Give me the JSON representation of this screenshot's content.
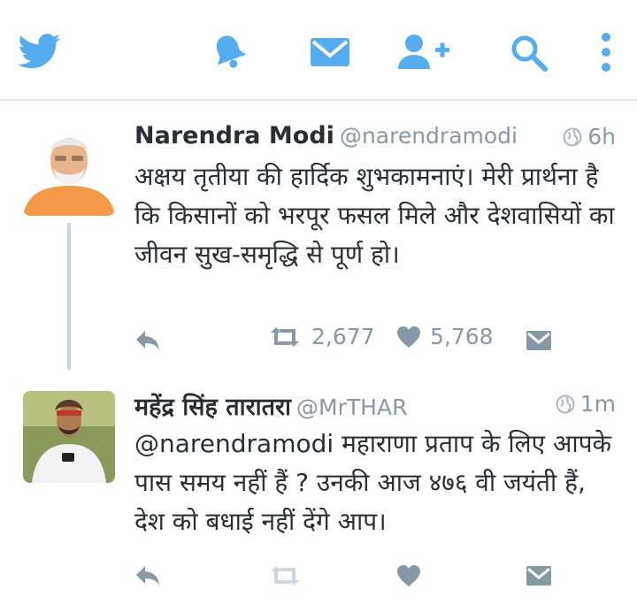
{
  "colors": {
    "brand": "#55acee",
    "muted": "#8899a6",
    "text": "#292f33",
    "divider": "#e1e8ed"
  },
  "nav": {
    "icons": [
      "twitter-bird-icon",
      "notifications-bell-icon",
      "messages-envelope-icon",
      "add-user-icon",
      "search-icon",
      "more-options-icon"
    ]
  },
  "tweets": [
    {
      "name": "Narendra Modi",
      "handle": "@narendramodi",
      "time": "6h",
      "text": "अक्षय तृतीया की हार्दिक शुभकामनाएं। मेरी प्रार्थना है कि किसानों को भरपूर फसल मिले और देशवासियों का जीवन सुख-समृद्धि से पूर्ण हो।",
      "retweets": "2,677",
      "likes": "5,768"
    },
    {
      "name": "महेंद्र सिंह तारातरा",
      "handle": "@MrTHAR",
      "time": "1m",
      "text": "@narendramodi महाराणा प्रताप के लिए आपके पास समय नहीं हैं ? उनकी आज ४७६ वी जयंती हैं, देश को बधाई नहीं देंगे आप।",
      "retweets": "",
      "likes": ""
    }
  ]
}
